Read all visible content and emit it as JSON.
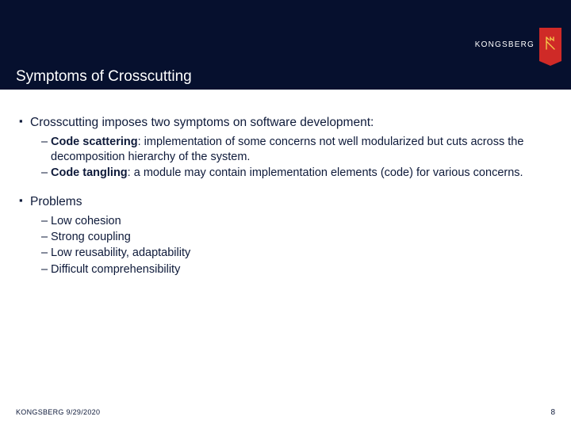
{
  "header": {
    "title": "Symptoms of Crosscutting",
    "logo_text": "KONGSBERG"
  },
  "content": {
    "point1": "Crosscutting imposes two symptoms on software development:",
    "sub1a_bold": "Code scattering",
    "sub1a_rest": ": implementation of some concerns not well modularized but cuts across the decomposition hierarchy of the system.",
    "sub1b_bold": "Code tangling",
    "sub1b_rest": ": a module may contain implementation elements (code) for various concerns.",
    "point2": "Problems",
    "sub2": [
      "Low cohesion",
      "Strong coupling",
      "Low reusability, adaptability",
      "Difficult comprehensibility"
    ]
  },
  "footer": {
    "left": "KONGSBERG 9/29/2020",
    "page": "8"
  }
}
